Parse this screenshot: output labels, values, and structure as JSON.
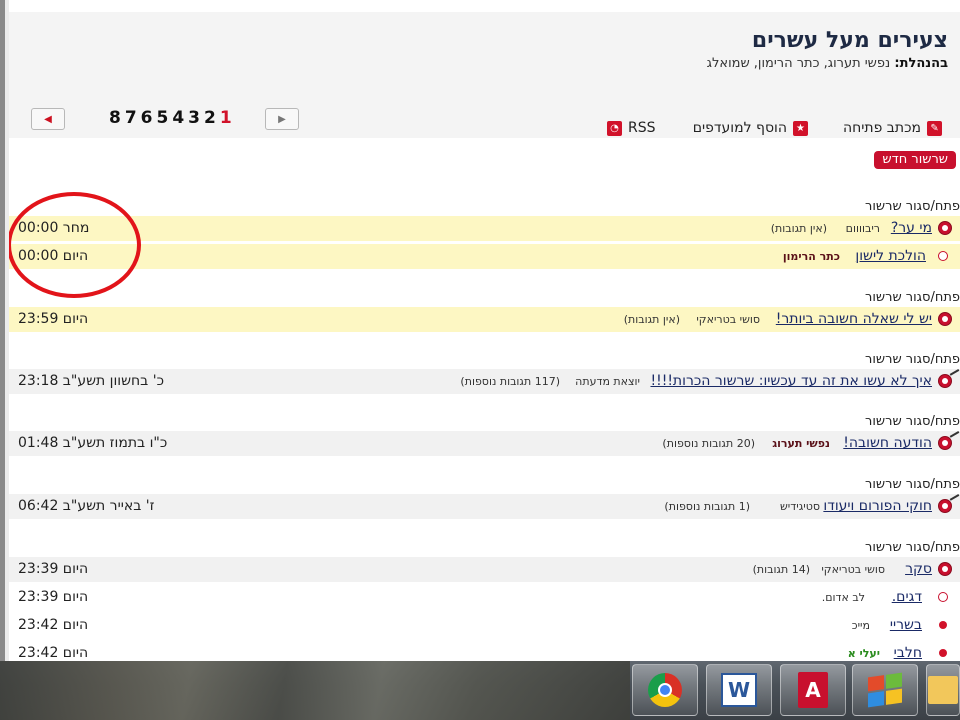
{
  "forum": {
    "title": "צעירים מעל עשרים",
    "managers_label": "בהנהלת:",
    "managers": "נפשי תערוג, כתר הרימון, שמואלג"
  },
  "pagination": {
    "prev_icon": "left-arrow-icon",
    "next_icon": "right-arrow-icon",
    "pages_text": "8765432",
    "current_page": "1"
  },
  "toolbar": {
    "opening_letter": "מכתב פתיחה",
    "add_favorites": "הוסף למועדפים",
    "rss": "RSS"
  },
  "new_thread": "שרשור חדש",
  "toggle_label": "פתח/סגור שרשור",
  "groups": [
    {
      "rows": [
        {
          "title": "מי ער?",
          "author": "ריבוווום",
          "replies": "(אין תגובות)",
          "date": "מחר 00:00"
        },
        {
          "title": "הולכת לישון",
          "author": "כתר הרימון",
          "replies": "",
          "date": "היום 00:00"
        }
      ]
    },
    {
      "rows": [
        {
          "title": "יש לי שאלה חשובה ביותר!",
          "author": "סושי בטריאקי",
          "replies": "(אין תגובות)",
          "date": "היום 23:59"
        }
      ]
    },
    {
      "rows": [
        {
          "title": "איך לא עשו את זה עד עכשיו: שרשור הכרות!!!!",
          "author": "יוצאת מדעתה",
          "replies": "(117 תגובות נוספות)",
          "date": "כ' בחשוון תשע\"ב 23:18"
        }
      ]
    },
    {
      "rows": [
        {
          "title": "הודעה חשובה!",
          "author": "נפשי תערוג",
          "replies": "(20 תגובות נוספות)",
          "date": "כ\"ו בתמוז תשע\"ב 01:48"
        }
      ]
    },
    {
      "rows": [
        {
          "title": "חוקי הפורום ויעודו",
          "author": "סטיגידיש",
          "replies": "(1 תגובות נוספות)",
          "date": "ז' באייר תשע\"ב 06:42"
        }
      ]
    },
    {
      "rows": [
        {
          "title": "סקר",
          "author": "סושי בטריאקי",
          "replies": "(14 תגובות)",
          "date": "היום 23:39"
        },
        {
          "title": "דגים.",
          "author": "לב אדום.",
          "replies": "",
          "date": "היום 23:39"
        },
        {
          "title": "בשריי",
          "author": "מייכ",
          "replies": "",
          "date": "היום 23:42"
        },
        {
          "title": "חלבי",
          "author": "יעלי א",
          "replies": "",
          "date": "היום 23:42"
        }
      ]
    }
  ],
  "taskbar": {
    "apps": [
      "chrome-icon",
      "word-icon",
      "pdf-icon",
      "windows-explorer-icon",
      "folder-icon"
    ],
    "word_letter": "W",
    "pdf_letter": "A"
  },
  "colors": {
    "accent_red": "#c8102e",
    "highlight_row": "#fdf7c3",
    "link": "#1a2a66",
    "annotation": "#e2141a"
  }
}
